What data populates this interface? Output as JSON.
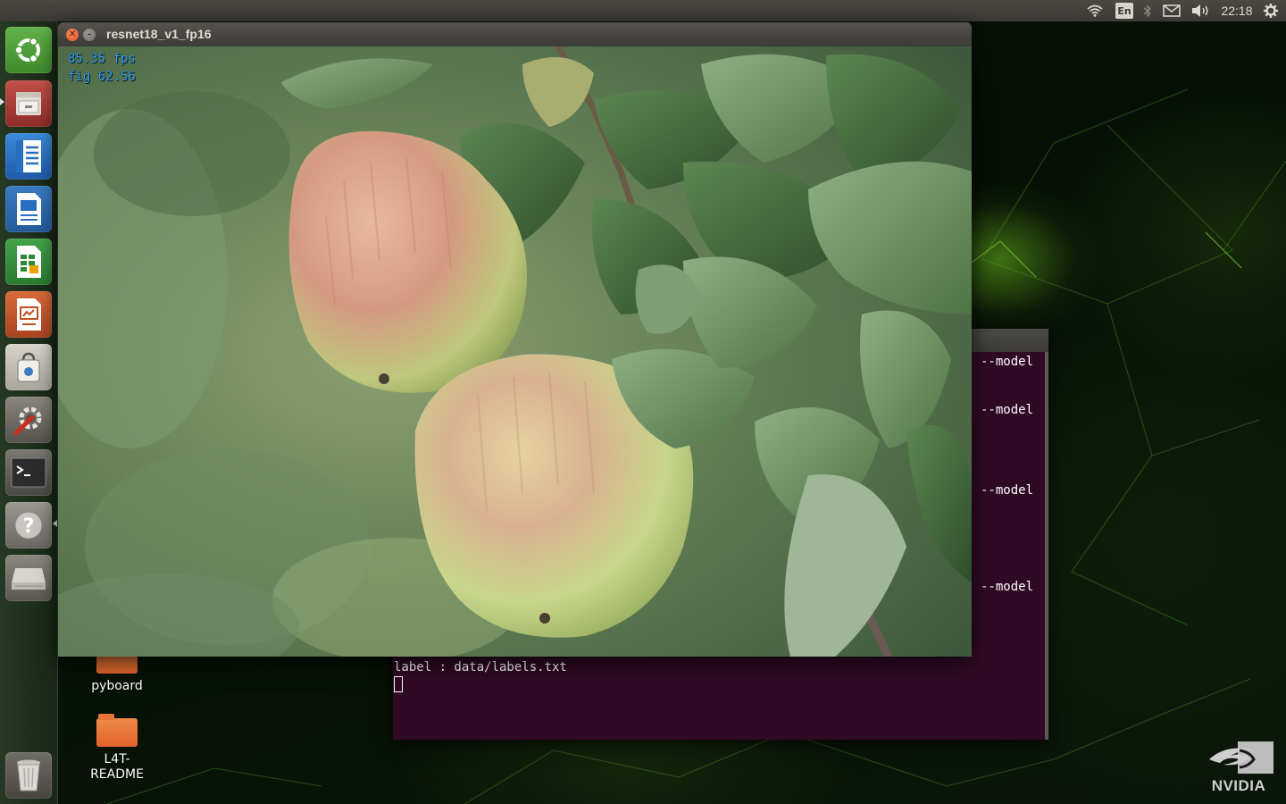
{
  "top_panel": {
    "language": "En",
    "clock": "22:18",
    "icons": [
      "wifi-icon",
      "keyboard-language-indicator",
      "bluetooth-icon",
      "mail-icon",
      "volume-icon",
      "settings-gear-icon"
    ]
  },
  "launcher": {
    "items": [
      {
        "name": "ubuntu-dash",
        "icon": "ubuntu-logo-icon"
      },
      {
        "name": "files",
        "icon": "file-cabinet-icon"
      },
      {
        "name": "text-editor",
        "icon": "text-document-icon"
      },
      {
        "name": "libreoffice-writer",
        "icon": "writer-document-icon"
      },
      {
        "name": "libreoffice-calc",
        "icon": "spreadsheet-icon"
      },
      {
        "name": "libreoffice-impress",
        "icon": "presentation-icon"
      },
      {
        "name": "software-center",
        "icon": "shopping-bag-icon"
      },
      {
        "name": "system-settings",
        "icon": "gear-wrench-icon"
      },
      {
        "name": "terminal",
        "icon": "terminal-icon"
      },
      {
        "name": "help",
        "icon": "question-mark-icon"
      },
      {
        "name": "removable-drive",
        "icon": "drive-icon"
      },
      {
        "name": "trash",
        "icon": "trash-icon"
      }
    ]
  },
  "desktop": {
    "icons": [
      {
        "label": "pyboard"
      },
      {
        "label": "L4T-\nREADME"
      }
    ],
    "brand": "NVIDIA"
  },
  "image_window": {
    "title": "resnet18_v1_fp16",
    "overlay_fps": "85.35 fps",
    "overlay_fig": "fig 62.56"
  },
  "terminal": {
    "model_lines": [
      "--model",
      "--model",
      "--model",
      "--model"
    ],
    "label_line": "label : data/labels.txt"
  },
  "colors": {
    "terminal_bg": "#300a24",
    "overlay_text": "#36a6f0",
    "panel_bg": "#3c3b37"
  }
}
